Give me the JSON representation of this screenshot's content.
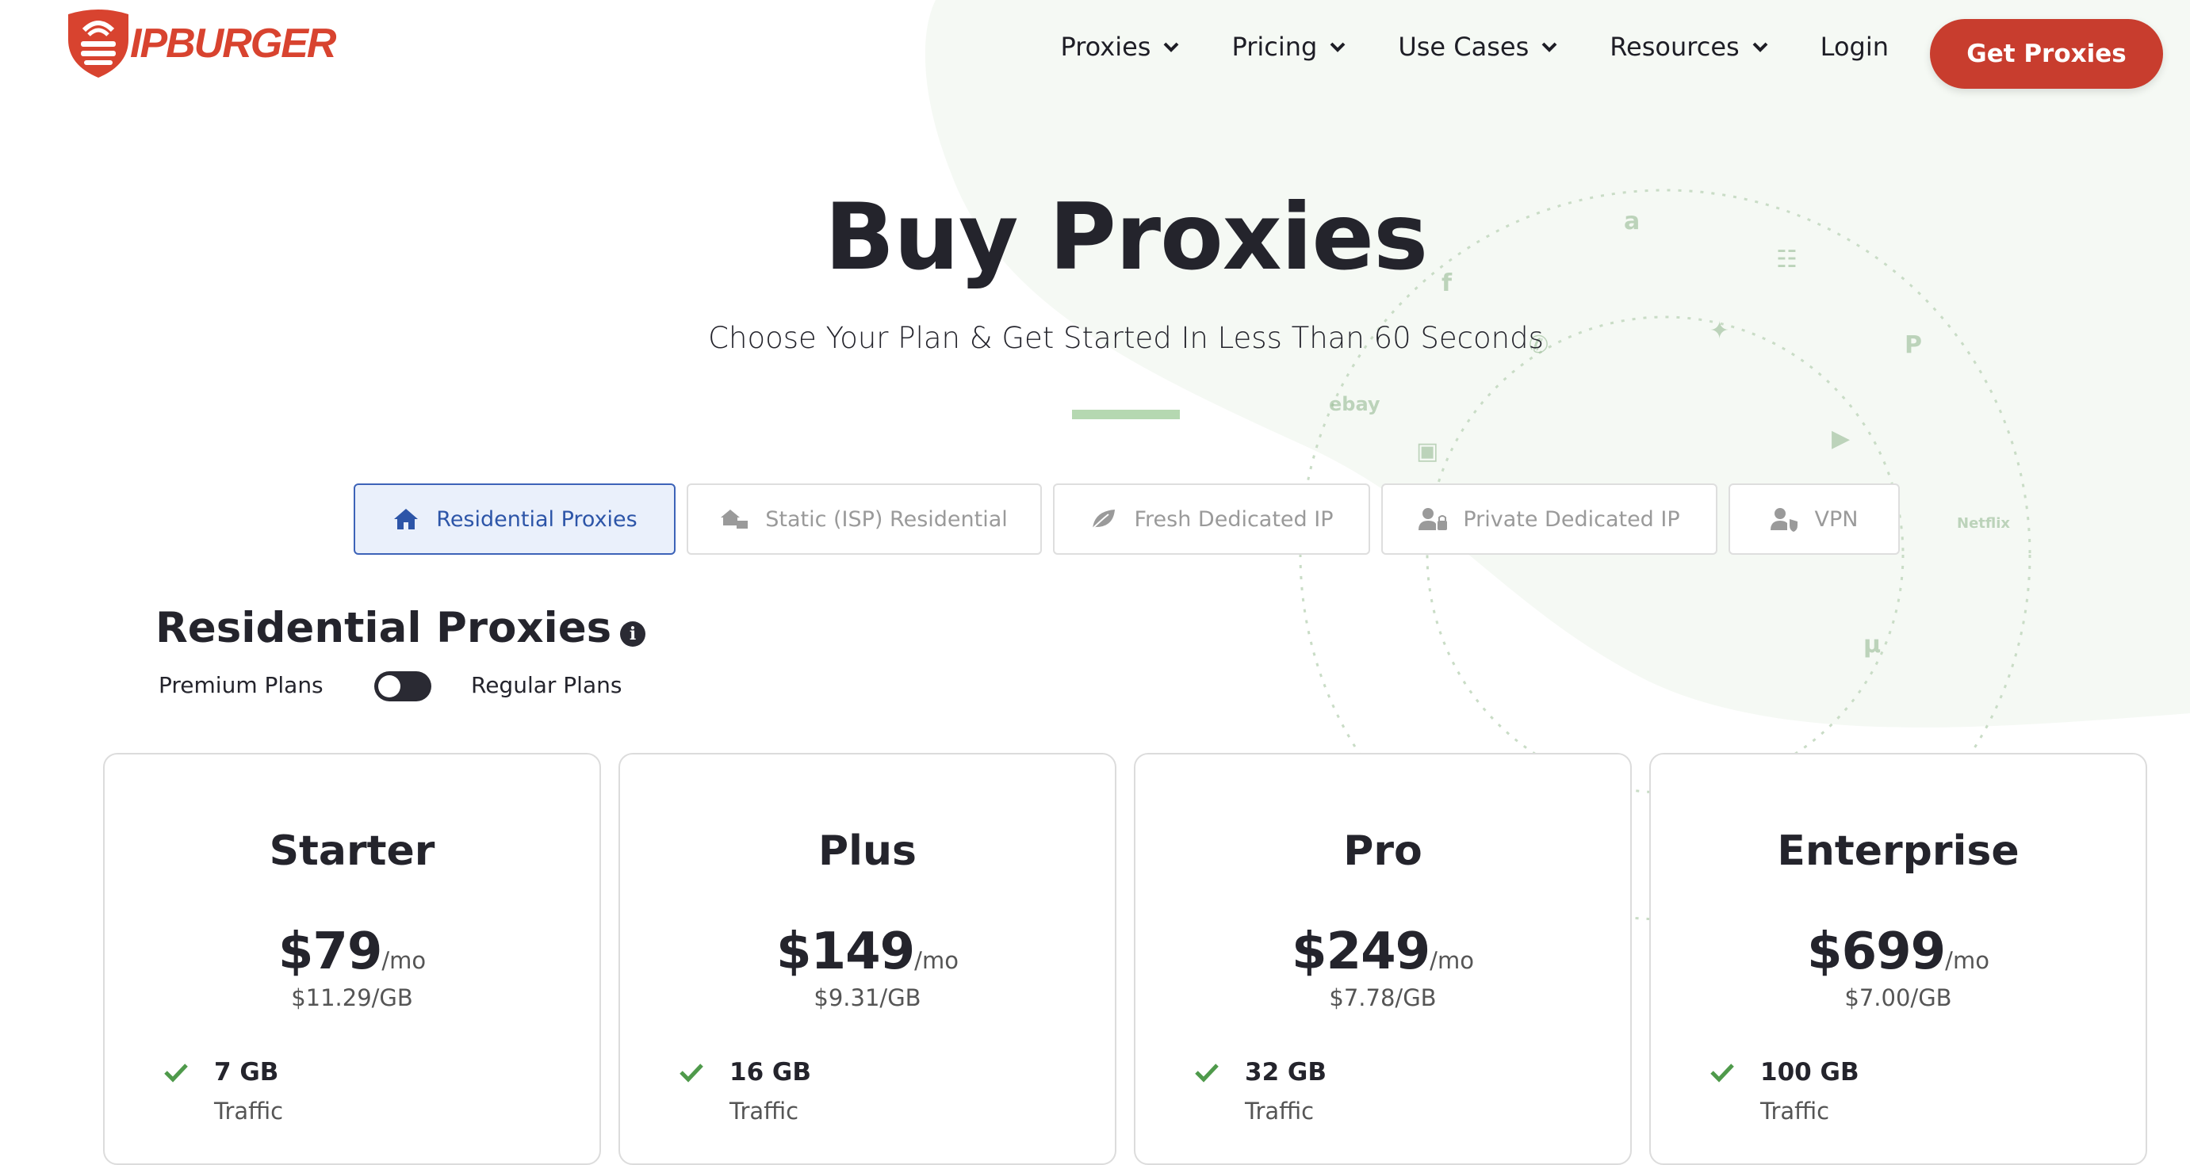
{
  "brand": {
    "name": "IPBurger",
    "logo_text": "IPBURGER",
    "accent": "#c83d2e"
  },
  "nav": {
    "items": [
      {
        "label": "Proxies",
        "has_dropdown": true
      },
      {
        "label": "Pricing",
        "has_dropdown": true
      },
      {
        "label": "Use Cases",
        "has_dropdown": true
      },
      {
        "label": "Resources",
        "has_dropdown": true
      },
      {
        "label": "Login",
        "has_dropdown": false
      }
    ],
    "cta_label": "Get Proxies"
  },
  "hero": {
    "title": "Buy Proxies",
    "subtitle": "Choose Your Plan & Get Started In Less Than 60 Seconds"
  },
  "decorations": {
    "social_icons": [
      "amazon-icon",
      "facebook-icon",
      "basket-icon",
      "twitter-icon",
      "whatsapp-icon",
      "paypal-icon",
      "ebay-icon",
      "instagram-icon",
      "youtube-icon",
      "netflix-icon",
      "utorrent-icon"
    ],
    "ebay_text": "ebay",
    "netflix_text": "Netflix"
  },
  "tabs": [
    {
      "label": "Residential Proxies",
      "icon": "home-icon",
      "active": true
    },
    {
      "label": "Static (ISP) Residential",
      "icon": "house-network-icon",
      "active": false
    },
    {
      "label": "Fresh Dedicated IP",
      "icon": "leaf-icon",
      "active": false
    },
    {
      "label": "Private Dedicated IP",
      "icon": "user-lock-icon",
      "active": false
    },
    {
      "label": "VPN",
      "icon": "user-shield-icon",
      "active": false
    }
  ],
  "section": {
    "title": "Residential Proxies",
    "toggle": {
      "left_label": "Premium Plans",
      "right_label": "Regular Plans",
      "state": "premium"
    }
  },
  "plans": [
    {
      "name": "Starter",
      "price": "$79",
      "period": "/mo",
      "per_gb": "$11.29/GB",
      "traffic": "7 GB",
      "traffic_label": "Traffic"
    },
    {
      "name": "Plus",
      "price": "$149",
      "period": "/mo",
      "per_gb": "$9.31/GB",
      "traffic": "16 GB",
      "traffic_label": "Traffic"
    },
    {
      "name": "Pro",
      "price": "$249",
      "period": "/mo",
      "per_gb": "$7.78/GB",
      "traffic": "32 GB",
      "traffic_label": "Traffic"
    },
    {
      "name": "Enterprise",
      "price": "$699",
      "period": "/mo",
      "per_gb": "$7.00/GB",
      "traffic": "100 GB",
      "traffic_label": "Traffic"
    }
  ]
}
